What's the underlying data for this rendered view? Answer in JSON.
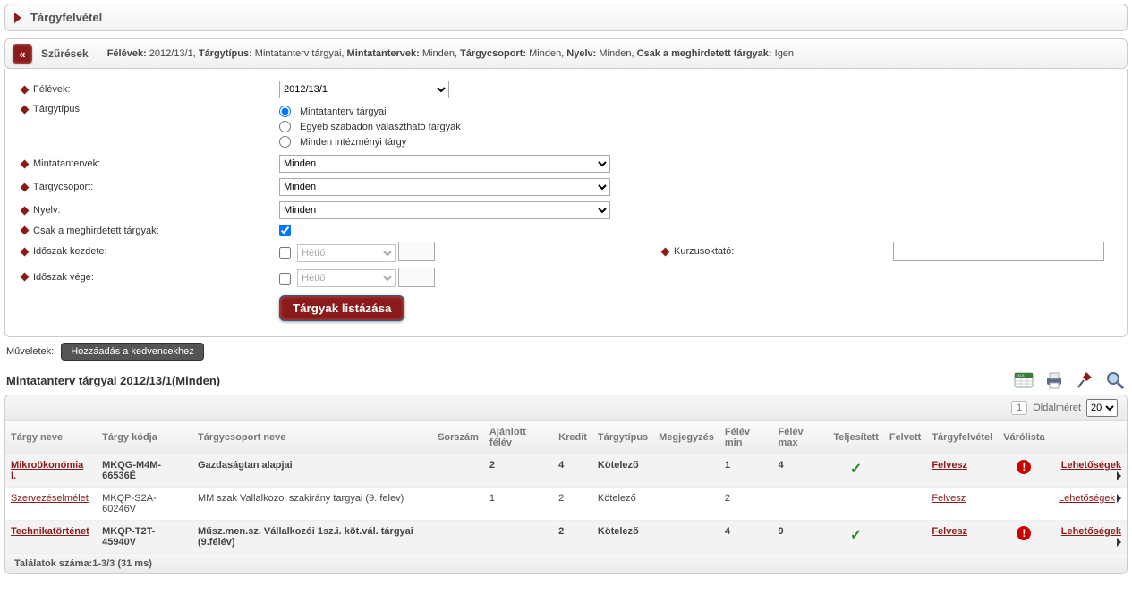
{
  "header": {
    "title": "Tárgyfelvétel"
  },
  "filters": {
    "label": "Szűrések",
    "summary": [
      {
        "k": "Félévek",
        "v": "2012/13/1"
      },
      {
        "k": "Tárgytípus",
        "v": "Mintatanterv tárgyai"
      },
      {
        "k": "Mintatantervek",
        "v": "Minden"
      },
      {
        "k": "Tárgycsoport",
        "v": "Minden"
      },
      {
        "k": "Nyelv",
        "v": "Minden"
      },
      {
        "k": "Csak a meghirdetett tárgyak",
        "v": "Igen"
      }
    ]
  },
  "form": {
    "felevek": {
      "label": "Félévek:",
      "value": "2012/13/1"
    },
    "targytipus": {
      "label": "Tárgytípus:",
      "options": [
        {
          "label": "Mintatanterv tárgyai",
          "checked": true
        },
        {
          "label": "Egyéb szabadon választható tárgyak",
          "checked": false
        },
        {
          "label": "Minden intézményi tárgy",
          "checked": false
        }
      ]
    },
    "mintatantervek": {
      "label": "Mintatantervek:",
      "value": "Minden"
    },
    "targycsoport": {
      "label": "Tárgycsoport:",
      "value": "Minden"
    },
    "nyelv": {
      "label": "Nyelv:",
      "value": "Minden"
    },
    "csakMeghirdetett": {
      "label": "Csak a meghirdetett tárgyak:",
      "checked": true
    },
    "idoszakKezdete": {
      "label": "Időszak kezdete:",
      "day": "Hétfő"
    },
    "idoszakVege": {
      "label": "Időszak vége:",
      "day": "Hétfő"
    },
    "kurzusoktato": {
      "label": "Kurzusoktató:",
      "value": ""
    },
    "listButton": "Tárgyak listázása"
  },
  "ops": {
    "label": "Műveletek:",
    "fav": "Hozzáadás a kedvencekhez"
  },
  "section": {
    "title": "Mintatanterv tárgyai 2012/13/1(Minden)"
  },
  "pager": {
    "page": "1",
    "pageSizeLabel": "Oldalméret",
    "pageSize": "20"
  },
  "table": {
    "headers": [
      "Tárgy neve",
      "Tárgy kódja",
      "Tárgycsoport neve",
      "Sorszám",
      "Ajánlott félév",
      "Kredit",
      "Tárgytípus",
      "Megjegyzés",
      "Félév min",
      "Félév max",
      "Teljesített",
      "Felvett",
      "Tárgyfelvétel",
      "Várólista",
      ""
    ],
    "rows": [
      {
        "bold": true,
        "alt": true,
        "name": "Mikroökonómia I.",
        "code": "MKQG-M4M-66536É",
        "group": "Gazdaságtan alapjai",
        "sor": "",
        "ajanlott": "2",
        "kredit": "4",
        "tipus": "Kötelező",
        "megj": "",
        "fmin": "1",
        "fmax": "4",
        "telj": true,
        "felvesz": "Felvesz",
        "varo": true,
        "lehet": "Lehetőségek"
      },
      {
        "bold": false,
        "alt": false,
        "name": "Szervezéselmélet",
        "code": "MKQP-S2A-60246V",
        "group": "MM szak Vallalkozoi szakirány targyai (9. felev)",
        "sor": "",
        "ajanlott": "1",
        "kredit": "2",
        "tipus": "Kötelező",
        "megj": "",
        "fmin": "2",
        "fmax": "",
        "telj": false,
        "felvesz": "Felvesz",
        "varo": false,
        "lehet": "Lehetőségek"
      },
      {
        "bold": true,
        "alt": true,
        "name": "Technikatörténet",
        "code": "MKQP-T2T-45940V",
        "group": "Műsz.men.sz. Vállalkozói 1sz.i. köt.vál. tárgyai (9.félév)",
        "sor": "",
        "ajanlott": "",
        "kredit": "2",
        "tipus": "Kötelező",
        "megj": "",
        "fmin": "4",
        "fmax": "9",
        "telj": true,
        "felvesz": "Felvesz",
        "varo": true,
        "lehet": "Lehetőségek"
      }
    ],
    "footer": "Találatok száma:1-3/3 (31 ms)"
  }
}
